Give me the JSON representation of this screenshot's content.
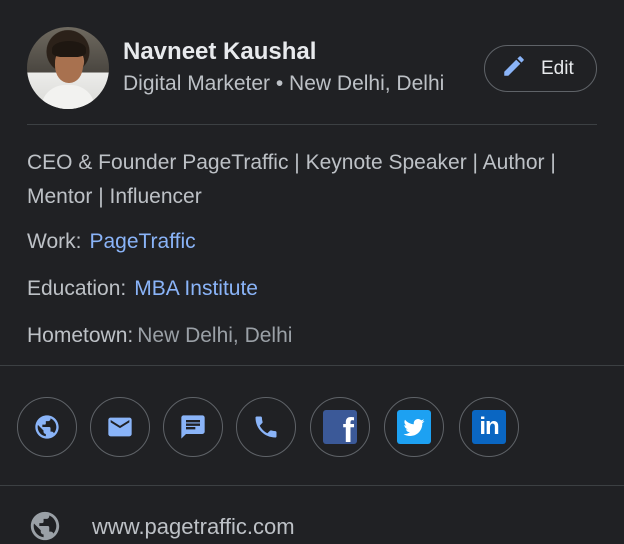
{
  "profile": {
    "name": "Navneet Kaushal",
    "subtitle": "Digital Marketer • New Delhi, Delhi",
    "edit_label": "Edit"
  },
  "about": {
    "bio": "CEO & Founder PageTraffic | Keynote Speaker | Author | Mentor | Influencer",
    "work_label": "Work:",
    "work_value": "PageTraffic",
    "education_label": "Education:",
    "education_value": "MBA Institute",
    "hometown_label": "Hometown:",
    "hometown_value": "New Delhi, Delhi"
  },
  "actions": [
    {
      "icon": "globe-icon"
    },
    {
      "icon": "email-icon"
    },
    {
      "icon": "message-icon"
    },
    {
      "icon": "phone-icon"
    },
    {
      "icon": "facebook-icon"
    },
    {
      "icon": "twitter-icon"
    },
    {
      "icon": "linkedin-icon"
    }
  ],
  "website": {
    "url": "www.pagetraffic.com",
    "icon": "globe-icon"
  },
  "colors": {
    "background": "#202124",
    "link": "#8ab4f8",
    "edit_icon": "#8ab4f8",
    "facebook": "#3b5998",
    "twitter": "#1da1f2",
    "linkedin": "#0a66c2"
  }
}
